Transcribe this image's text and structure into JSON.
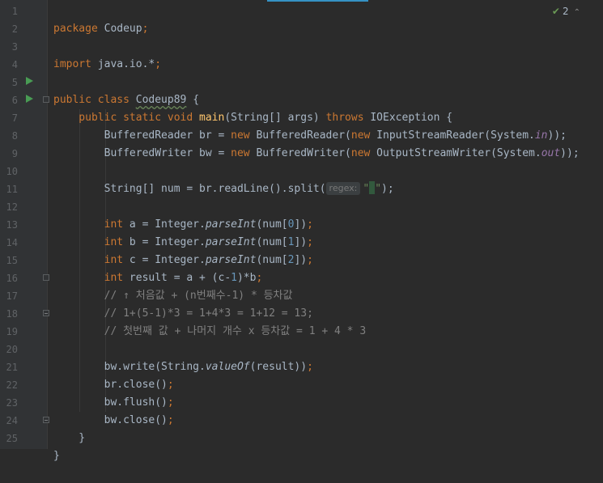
{
  "editor": {
    "inspection": {
      "count": "2",
      "check_icon": "check-icon",
      "chevron_icon": "chevron-up-icon"
    },
    "hint_label": "regex:",
    "lines": [
      {
        "n": "1"
      },
      {
        "n": "2"
      },
      {
        "n": "3"
      },
      {
        "n": "4"
      },
      {
        "n": "5"
      },
      {
        "n": "6"
      },
      {
        "n": "7"
      },
      {
        "n": "8"
      },
      {
        "n": "9"
      },
      {
        "n": "10"
      },
      {
        "n": "11"
      },
      {
        "n": "12"
      },
      {
        "n": "13"
      },
      {
        "n": "14"
      },
      {
        "n": "15"
      },
      {
        "n": "16"
      },
      {
        "n": "17"
      },
      {
        "n": "18"
      },
      {
        "n": "19"
      },
      {
        "n": "20"
      },
      {
        "n": "21"
      },
      {
        "n": "22"
      },
      {
        "n": "23"
      },
      {
        "n": "24"
      },
      {
        "n": "25"
      }
    ],
    "code": {
      "l1": {
        "a": "package",
        "b": " Codeup",
        "c": ";"
      },
      "l3": {
        "a": "import",
        "b": " java.io.*",
        "c": ";"
      },
      "l5": {
        "a": "public class",
        "b": " ",
        "c": "Codeup89",
        "d": " {"
      },
      "l6": {
        "a": "    public static void",
        "b": " ",
        "c": "main",
        "d": "(String[] args) ",
        "e": "throws",
        "f": " IOException {"
      },
      "l7": {
        "a": "        BufferedReader br = ",
        "b": "new",
        "c": " BufferedReader(",
        "d": "new",
        "e": " InputStreamReader(System.",
        "f": "in",
        "g": "));"
      },
      "l8": {
        "a": "        BufferedWriter bw = ",
        "b": "new",
        "c": " BufferedWriter(",
        "d": "new",
        "e": " OutputStreamWriter(System.",
        "f": "out",
        "g": "));"
      },
      "l10": {
        "a": "        String[] num = br.readLine().split(",
        "b": "\"",
        "c": " ",
        "d": "\"",
        "e": ");"
      },
      "l12": {
        "a": "        int",
        "b": " a = Integer.",
        "c": "parseInt",
        "d": "(num[",
        "e": "0",
        "f": "])",
        "g": ";"
      },
      "l13": {
        "a": "        int",
        "b": " b = Integer.",
        "c": "parseInt",
        "d": "(num[",
        "e": "1",
        "f": "])",
        "g": ";"
      },
      "l14": {
        "a": "        int",
        "b": " c = Integer.",
        "c": "parseInt",
        "d": "(num[",
        "e": "2",
        "f": "])",
        "g": ";"
      },
      "l15": {
        "a": "        int",
        "b": " result = a + (c-",
        "c": "1",
        "d": ")*b",
        "e": ";"
      },
      "l16": {
        "a": "        // ↑ 처음값 + (n번째수-1) * 등차값"
      },
      "l17": {
        "a": "        // 1+(5-1)*3 = 1+4*3 = 1+12 = 13;"
      },
      "l18": {
        "a": "        // 첫번째 값 + 나머지 개수 x 등차값 = 1 + 4 * 3"
      },
      "l20": {
        "a": "        bw.write(String.",
        "b": "valueOf",
        "c": "(result))",
        "d": ";"
      },
      "l21": {
        "a": "        br.close()",
        "b": ";"
      },
      "l22": {
        "a": "        bw.flush()",
        "b": ";"
      },
      "l23": {
        "a": "        bw.close()",
        "b": ";"
      },
      "l24": {
        "a": "    }"
      },
      "l25": {
        "a": "}"
      }
    }
  }
}
